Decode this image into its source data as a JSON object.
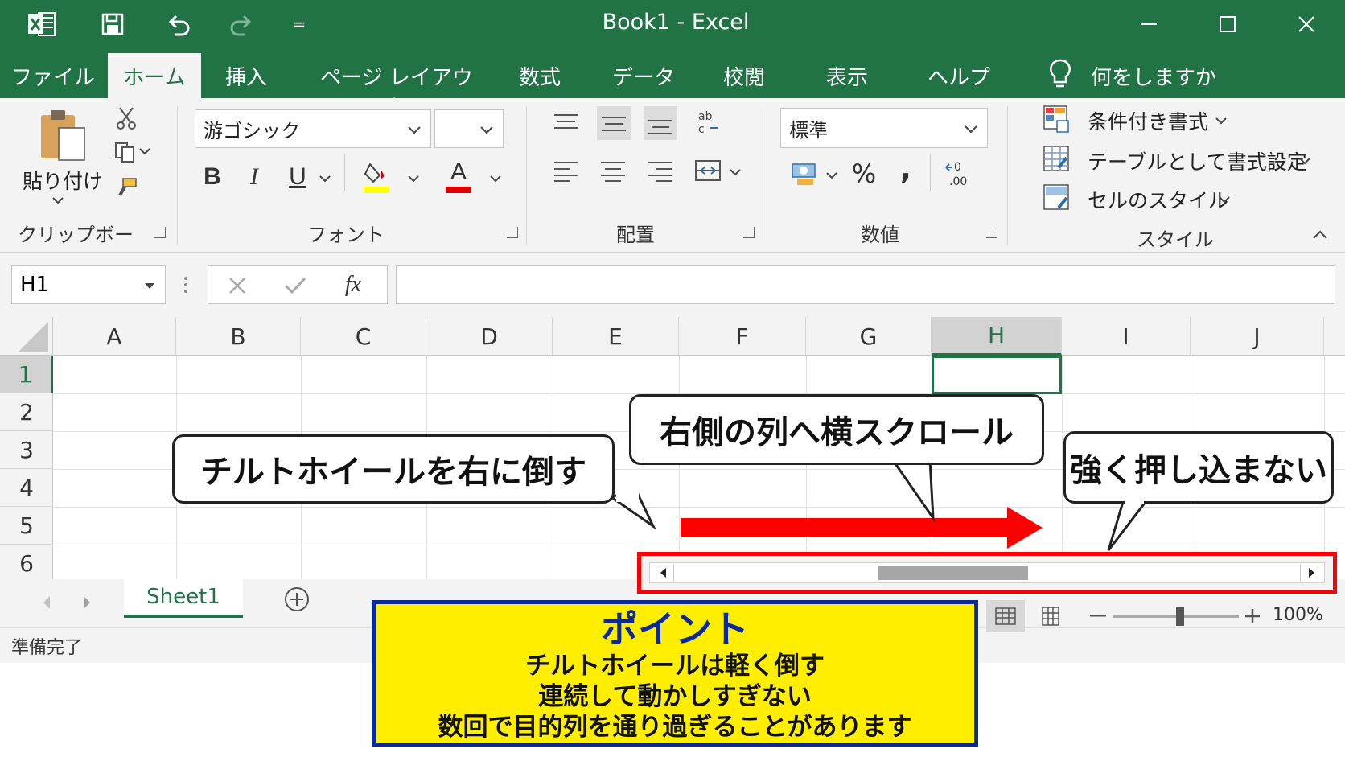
{
  "window": {
    "title": "Book1  -  Excel"
  },
  "quick_access": {
    "customize_glyph": "="
  },
  "tabs": [
    "ファイル",
    "ホーム",
    "挿入",
    "ページ レイアウト",
    "数式",
    "データ",
    "校閲",
    "表示",
    "ヘルプ"
  ],
  "tell_me": "何をしますか",
  "ribbon": {
    "clipboard": {
      "paste_label": "貼り付け",
      "group_label": "クリップボード"
    },
    "font": {
      "font_name": "游ゴシック",
      "font_size": "",
      "bold": "B",
      "italic": "I",
      "underline": "U",
      "font_color_glyph": "A",
      "group_label": "フォント"
    },
    "alignment": {
      "group_label": "配置"
    },
    "number": {
      "format": "標準",
      "percent": "%",
      "comma": ",",
      "group_label": "数値"
    },
    "styles": {
      "conditional": "条件付き書式",
      "as_table": "テーブルとして書式設定",
      "cell_styles": "セルのスタイル",
      "group_label": "スタイル"
    },
    "colors": {
      "accent": "#217346",
      "ribbon_bg": "#f3f3f3"
    }
  },
  "formula_bar": {
    "name_box": "H1",
    "fx": "fx",
    "formula": ""
  },
  "grid": {
    "columns": [
      "A",
      "B",
      "C",
      "D",
      "E",
      "F",
      "G",
      "H",
      "I",
      "J"
    ],
    "rows": [
      "1",
      "2",
      "3",
      "4",
      "5",
      "6"
    ],
    "selected_column": "H",
    "selected_row": "1"
  },
  "sheet_tabs": {
    "active": "Sheet1"
  },
  "status": {
    "ready": "準備完了",
    "zoom": "100%"
  },
  "annotations": {
    "callout_tilt": "チルトホイールを右に倒す",
    "callout_scroll": "右側の列へ横スクロール",
    "callout_press": "強く押し込まない",
    "point_title": "ポイント",
    "point_line1": "チルトホイールは軽く倒す",
    "point_line2": "連続して動かしすぎない",
    "point_line3": "数回で目的列を通り過ぎることがあります",
    "highlight_color": "#ff0000",
    "point_bg": "#ffee00",
    "point_border": "#0a2a9a"
  }
}
